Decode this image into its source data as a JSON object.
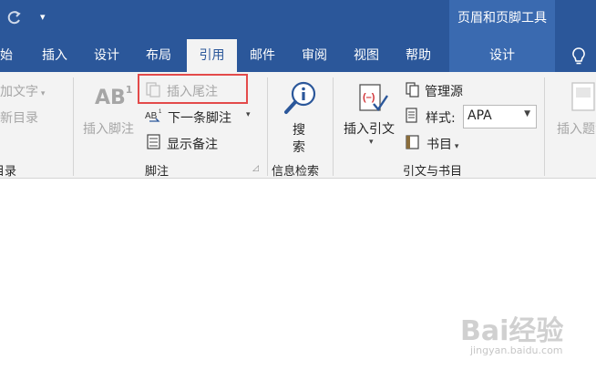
{
  "titlebar": {
    "qat_glyph": "▾",
    "context_tab_group": "页眉和页脚工具"
  },
  "tabs": [
    {
      "label": "开始",
      "visible_part": "开始",
      "state": "normal"
    },
    {
      "label": "插入",
      "state": "normal"
    },
    {
      "label": "设计",
      "state": "normal"
    },
    {
      "label": "布局",
      "state": "normal"
    },
    {
      "label": "引用",
      "state": "active"
    },
    {
      "label": "邮件",
      "state": "normal"
    },
    {
      "label": "审阅",
      "state": "normal"
    },
    {
      "label": "视图",
      "state": "normal"
    },
    {
      "label": "帮助",
      "state": "normal"
    },
    {
      "label": "设计",
      "state": "contextual"
    }
  ],
  "ribbon": {
    "toc_group": {
      "add_text": "添加文字",
      "update_toc": "更新目录",
      "label": "目录"
    },
    "footnotes_group": {
      "insert_footnote": "插入脚注",
      "insert_endnote": "插入尾注",
      "next_footnote": "下一条脚注",
      "show_notes": "显示备注",
      "label": "脚注",
      "ab_glyph": "AB",
      "sup_glyph": "1"
    },
    "research_group": {
      "search_line1": "搜",
      "search_line2": "索",
      "label": "信息检索"
    },
    "citations_group": {
      "insert_citation": "插入引文",
      "manage_sources": "管理源",
      "style_label": "样式:",
      "style_value": "APA",
      "bibliography": "书目",
      "label": "引文与书目"
    },
    "captions_group": {
      "insert_caption": "插入题注"
    }
  },
  "watermark": {
    "brand": "Bai经验",
    "url": "jingyan.baidu.com"
  },
  "colors": {
    "title_blue": "#2b579a",
    "context_blue": "#3a6ab0",
    "ribbon_bg": "#f3f3f3",
    "highlight_red": "#e34a4a"
  }
}
